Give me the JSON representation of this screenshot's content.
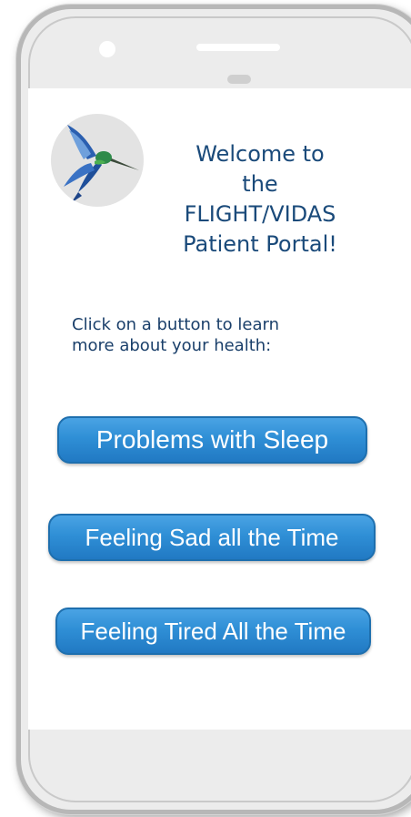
{
  "welcome": {
    "line1": "Welcome to",
    "line2": "the",
    "line3": "FLIGHT/VIDAS",
    "line4": "Patient Portal!"
  },
  "prompt": {
    "line1": "Click on a button to learn",
    "line2": "more about your health:"
  },
  "buttons": {
    "sleep": "Problems with Sleep",
    "sad": "Feeling Sad all the Time",
    "tired": "Feeling Tired All the Time"
  },
  "logo": {
    "icon": "hummingbird-icon"
  },
  "colors": {
    "title_text": "#1a4a7a",
    "button_fill": "#2f8fd6",
    "button_border": "#1e6fae",
    "button_text": "#ffffff"
  }
}
